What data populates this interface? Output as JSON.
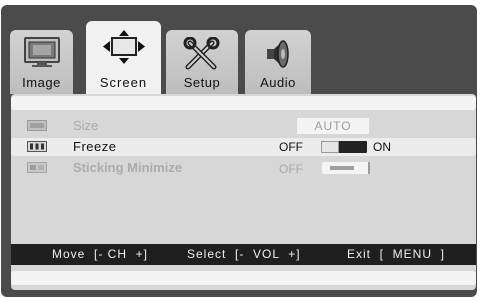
{
  "tabs": [
    {
      "label": "Image",
      "icon": "monitor-icon"
    },
    {
      "label": "Screen",
      "icon": "screen-arrows-icon",
      "active": true
    },
    {
      "label": "Setup",
      "icon": "tools-icon"
    },
    {
      "label": "Audio",
      "icon": "speaker-icon"
    }
  ],
  "menu": {
    "rows": [
      {
        "label": "Size",
        "value": "AUTO",
        "enabled": false
      },
      {
        "label": "Freeze",
        "off": "OFF",
        "on": "ON",
        "selected": true
      },
      {
        "label": "Sticking Minimize",
        "off": "OFF",
        "enabled": false
      }
    ]
  },
  "footer": {
    "move": "Move  [- CH  +]",
    "select": "Select  [-  VOL  +]",
    "exit": "Exit  [  MENU  ]"
  },
  "colors": {
    "frame": "#4b4b4b",
    "panel": "#d7d7d7",
    "footer": "#1f1f1f"
  }
}
